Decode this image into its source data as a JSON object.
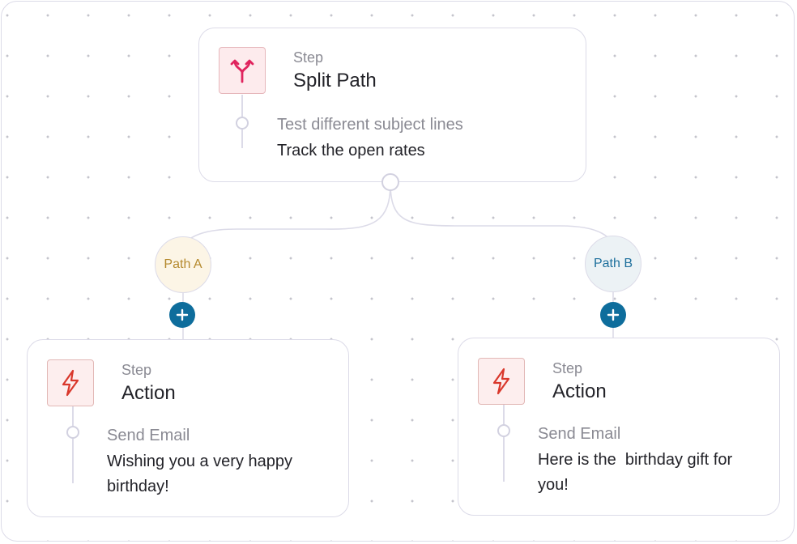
{
  "split_step": {
    "step_label": "Step",
    "title": "Split Path",
    "icon": "split-arrows-icon",
    "item_label": "Test different subject lines",
    "item_value": "Track the open rates"
  },
  "paths": [
    {
      "label": "Path A"
    },
    {
      "label": "Path B"
    }
  ],
  "action_steps": [
    {
      "step_label": "Step",
      "title": "Action",
      "icon": "lightning-icon",
      "item_label": "Send Email",
      "item_value": "Wishing you a very happy birthday!"
    },
    {
      "step_label": "Step",
      "title": "Action",
      "icon": "lightning-icon",
      "item_label": "Send Email",
      "item_value": "Here is the  birthday gift for you!"
    }
  ],
  "colors": {
    "accent": "#0e6d9c",
    "split_icon": "#e0245e",
    "action_icon": "#d9382c",
    "path_a_text": "#b58a2e",
    "path_b_text": "#1d6f9c"
  }
}
